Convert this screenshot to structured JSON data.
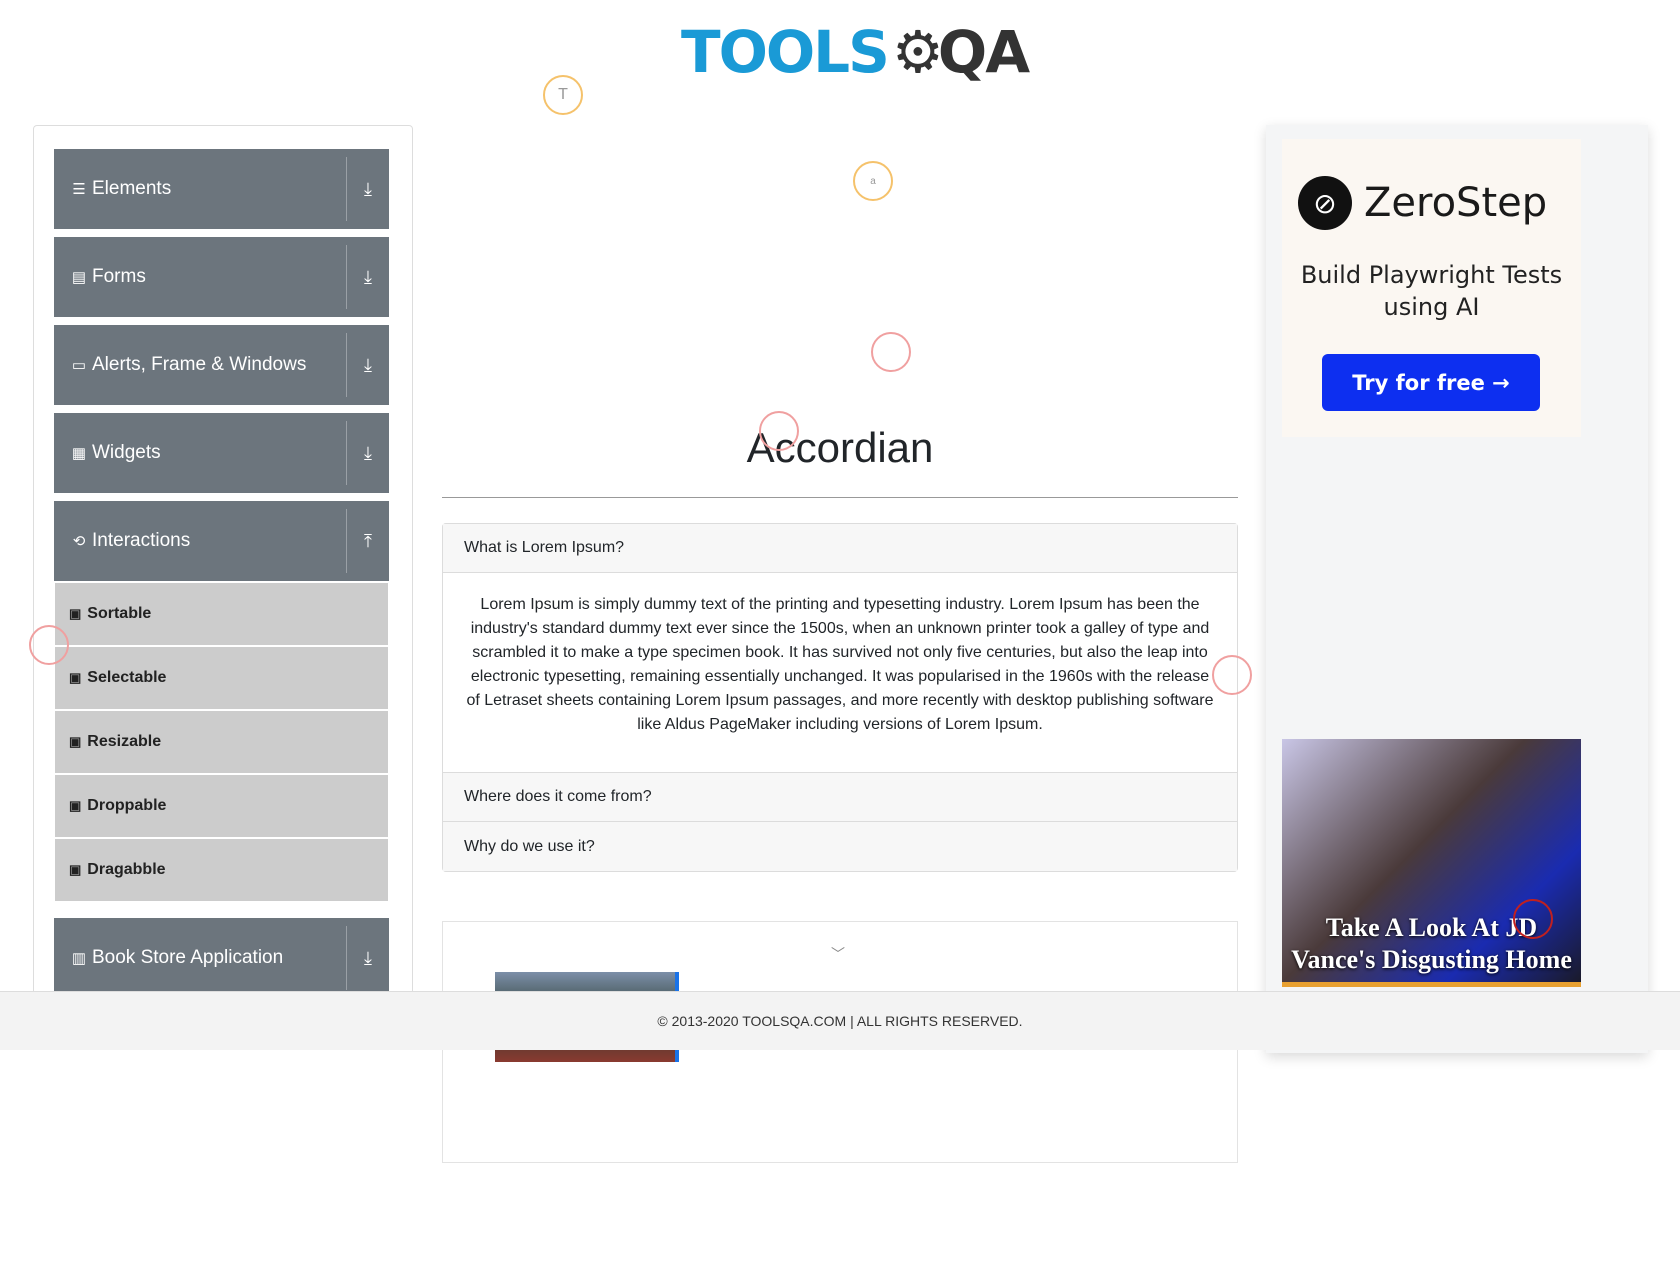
{
  "header": {
    "logo_text": "TOOLS",
    "logo_suffix": "QA"
  },
  "sidebar": {
    "groups": [
      {
        "label": "Elements",
        "icon": "☰",
        "arrow": "⤓"
      },
      {
        "label": "Forms",
        "icon": "▤",
        "arrow": "⤓"
      },
      {
        "label": "Alerts, Frame & Windows",
        "icon": "▭",
        "arrow": "⤓"
      },
      {
        "label": "Widgets",
        "icon": "▦",
        "arrow": "⤓"
      },
      {
        "label": "Interactions",
        "icon": "⟲",
        "arrow": "⤒"
      },
      {
        "label": "Book Store Application",
        "icon": "▥",
        "arrow": "⤓"
      }
    ],
    "sub_items": [
      "Sortable",
      "Selectable",
      "Resizable",
      "Droppable",
      "Dragabble"
    ]
  },
  "main": {
    "title": "Accordian",
    "sections": [
      {
        "header": "What is Lorem Ipsum?",
        "body": "Lorem Ipsum is simply dummy text of the printing and typesetting industry. Lorem Ipsum has been the industry's standard dummy text ever since the 1500s, when an unknown printer took a galley of type and scrambled it to make a type specimen book. It has survived not only five centuries, but also the leap into electronic typesetting, remaining essentially unchanged. It was popularised in the 1960s with the release of Letraset sheets containing Lorem Ipsum passages, and more recently with desktop publishing software like Aldus PageMaker including versions of Lorem Ipsum."
      },
      {
        "header": "Where does it come from?"
      },
      {
        "header": "Why do we use it?"
      }
    ]
  },
  "ad_right": {
    "brand": "ZeroStep",
    "tagline": "Build Playwright Tests using AI",
    "cta": "Try for free →",
    "photo_caption": "Take A Look At JD Vance's Disgusting Home"
  },
  "markers": {
    "t": "T",
    "a": "a"
  },
  "footer": {
    "text": "© 2013-2020 TOOLSQA.COM | ALL RIGHTS RESERVED."
  }
}
